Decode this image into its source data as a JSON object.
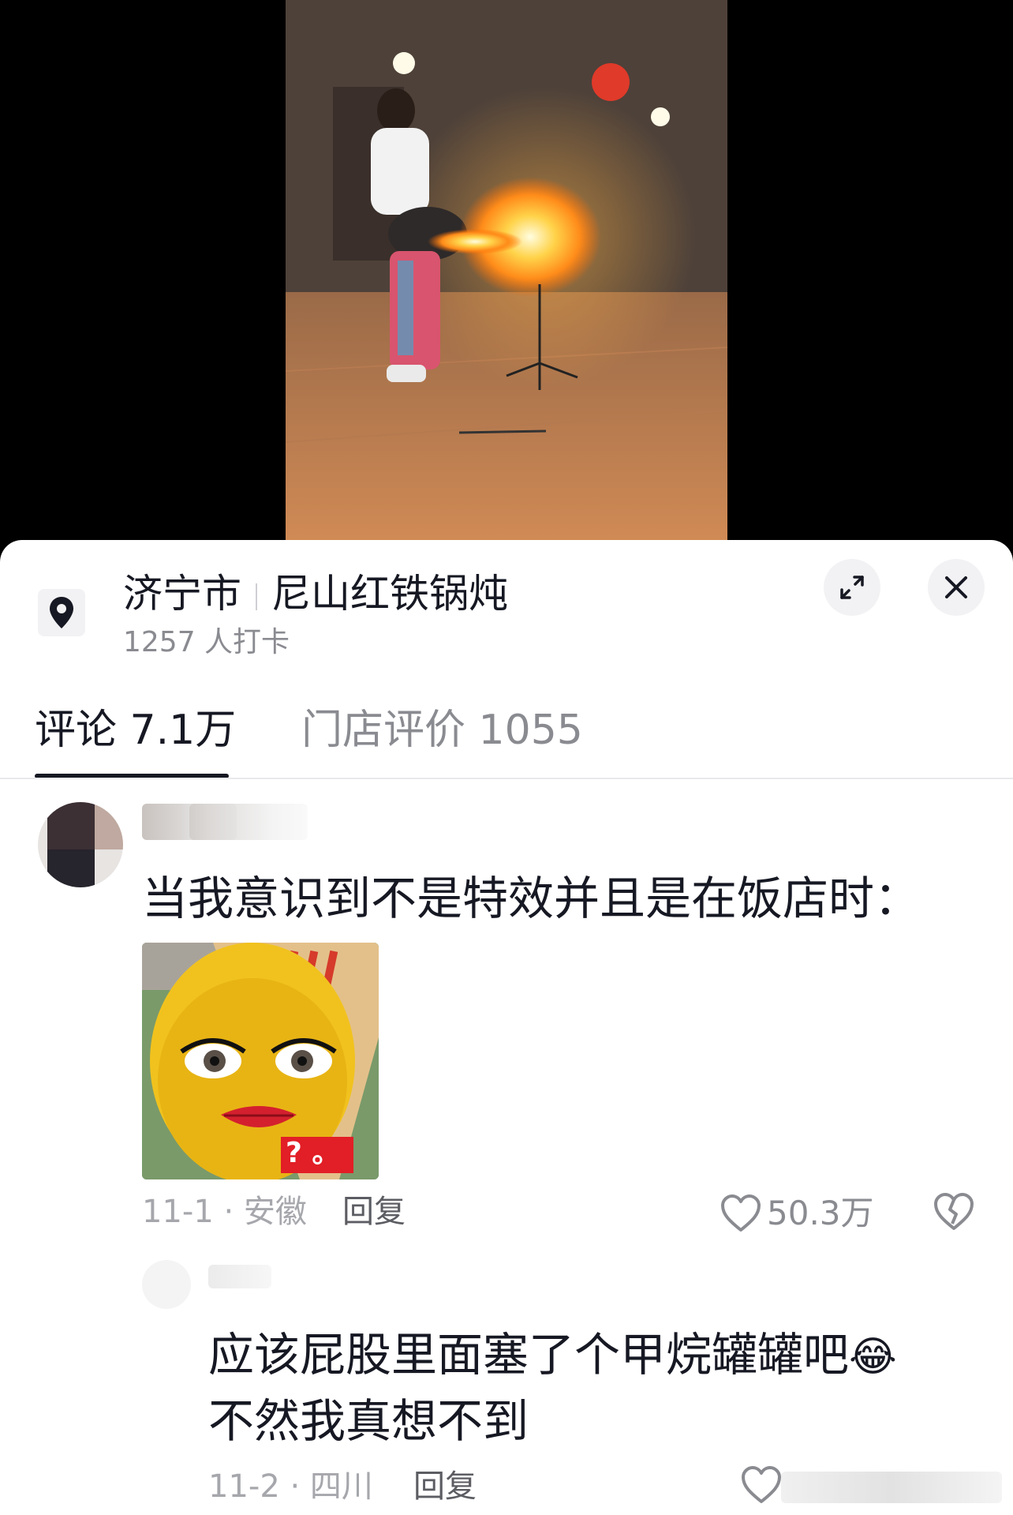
{
  "location": {
    "city": "济宁市",
    "place": "尼山红铁锅炖",
    "checkins": "1257 人打卡"
  },
  "tabs": [
    {
      "label": "评论 7.1万",
      "active": true
    },
    {
      "label": "门店评价 1055",
      "active": false
    }
  ],
  "comments": [
    {
      "text": "当我意识到不是特效并且是在饭店时：",
      "image_badge": "? 。",
      "date_region": "11-1 · 安徽",
      "reply_label": "回复",
      "likes": "50.3万"
    },
    {
      "text_line1": "应该屁股里面塞了个甲烷罐罐吧",
      "emoji": "😂",
      "text_line2": "不然我真想不到",
      "date_region": "11-2 · 四川",
      "reply_label": "回复"
    }
  ],
  "icons": {
    "location": "location-pin-icon",
    "expand": "expand-icon",
    "close": "close-icon",
    "like": "heart-icon",
    "dislike": "broken-heart-icon"
  },
  "colors": {
    "primary_text": "#161823",
    "secondary_text": "#8a8b91",
    "muted_text": "#a6a7ac"
  }
}
